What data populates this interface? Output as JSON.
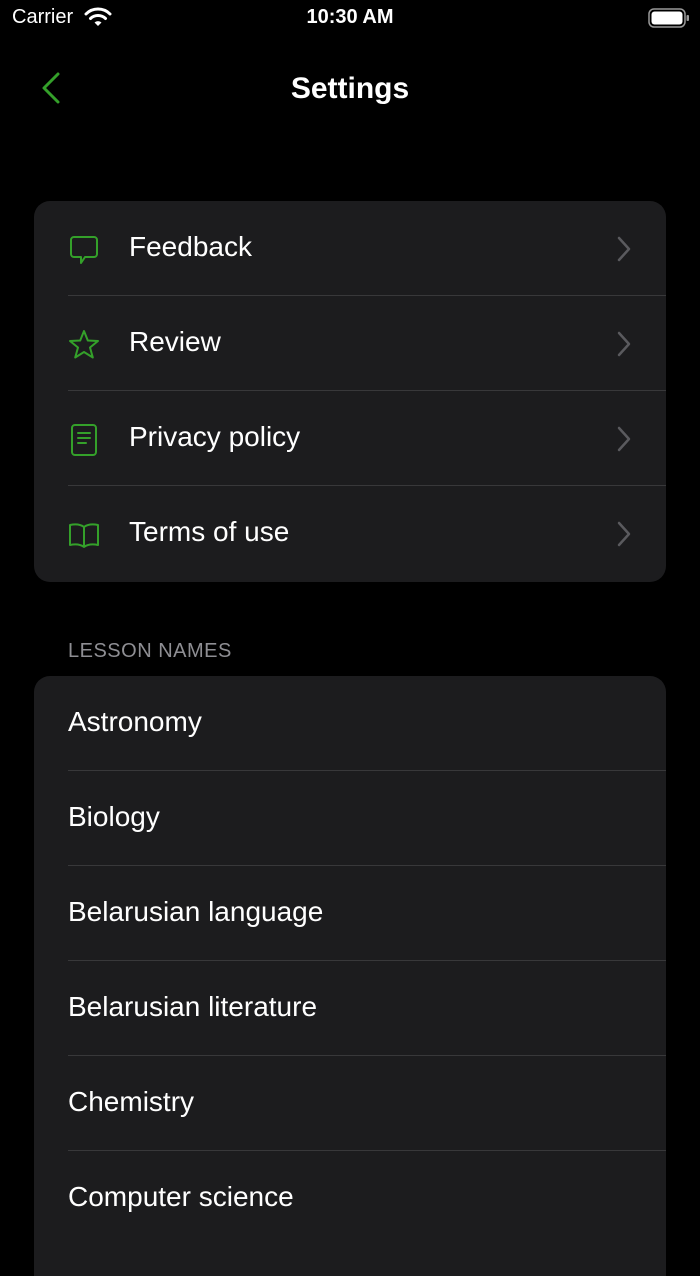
{
  "status_bar": {
    "carrier": "Carrier",
    "time": "10:30 AM"
  },
  "nav": {
    "title": "Settings"
  },
  "settings_items": [
    {
      "label": "Feedback",
      "icon": "message-bubble-icon"
    },
    {
      "label": "Review",
      "icon": "star-icon"
    },
    {
      "label": "Privacy policy",
      "icon": "document-icon"
    },
    {
      "label": "Terms of use",
      "icon": "book-icon"
    }
  ],
  "lessons": {
    "header": "LESSON NAMES",
    "items": [
      "Astronomy",
      "Biology",
      "Belarusian language",
      "Belarusian literature",
      "Chemistry",
      "Computer science"
    ]
  },
  "colors": {
    "accent": "#34a02a",
    "background": "#000000",
    "cell": "#1c1c1e",
    "separator": "#38383a"
  }
}
